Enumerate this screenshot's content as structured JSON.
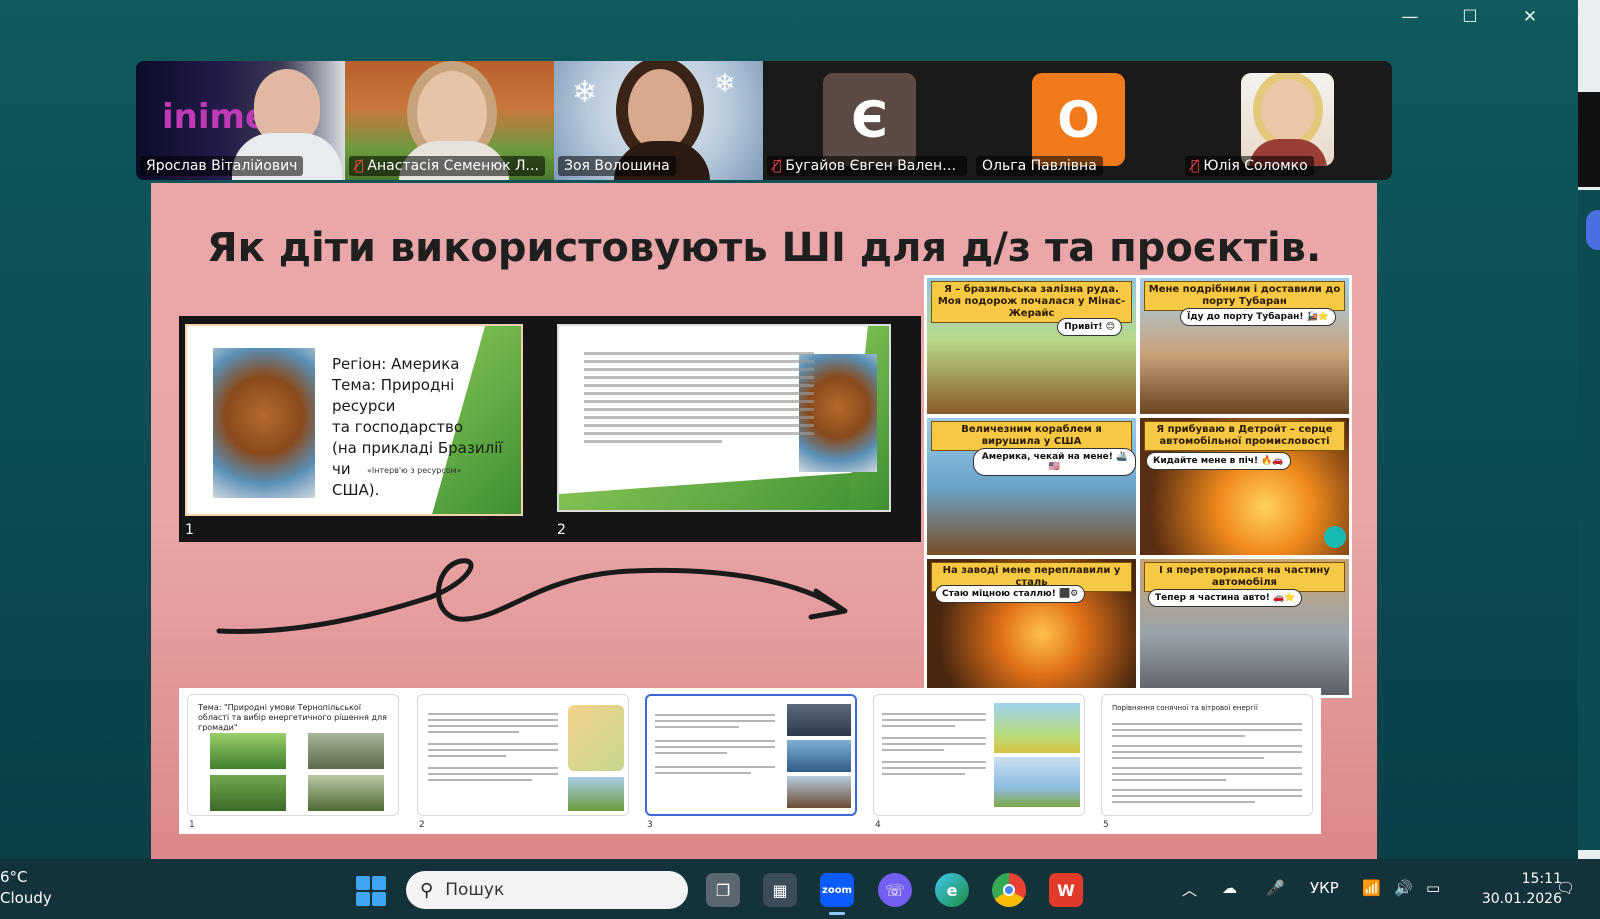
{
  "window": {
    "minimize_icon": "—",
    "maximize_icon": "☐",
    "close_icon": "✕"
  },
  "participants": [
    {
      "name": "Ярослав Віталійович",
      "muted": false,
      "type": "video"
    },
    {
      "name": "Анастасія Семенюк Л...",
      "muted": true,
      "type": "video"
    },
    {
      "name": "Зоя Волошина",
      "muted": false,
      "type": "video",
      "active": true
    },
    {
      "name": "Бугайов Євген Валент...",
      "muted": true,
      "type": "avatar",
      "letter": "Є",
      "color": "#5c4a44"
    },
    {
      "name": "Ольга Павлівна",
      "muted": false,
      "type": "avatar",
      "letter": "О",
      "color": "#f27a1a"
    },
    {
      "name": "Юлія Соломко",
      "muted": true,
      "type": "video"
    }
  ],
  "tile1_logo": "inime",
  "slide": {
    "title": "Як діти використовують ШІ для д/з та проєктів.",
    "mini1": {
      "lines": [
        "Регіон: Америка",
        "Тема: Природні ресурси",
        "та господарство",
        " (на прикладі Бразилії чи",
        "США)."
      ],
      "sub": "«Інтерв'ю з ресурсом»",
      "num": "1"
    },
    "mini2": {
      "num": "2"
    },
    "comic": [
      {
        "caption": "Я – бразильська залізна руда. Моя подорож почалася у Мінас-Жерайс",
        "bubble": "Привіт! 😊"
      },
      {
        "caption": "Мене подрібнили і доставили до порту Тубаран",
        "bubble": "Їду до порту Тубаран! 🚂⭐"
      },
      {
        "caption": "Величезним кораблем я вирушила у США",
        "bubble": "Америка, чекай на мене! 🚢🇺🇸"
      },
      {
        "caption": "Я прибуваю в Детройт – серце автомобільної промисловості",
        "bubble": "Кидайте мене в піч! 🔥🚗"
      },
      {
        "caption": "На заводі мене переплавили у сталь",
        "bubble": "Стаю міцною сталлю! ⬛⚙"
      },
      {
        "caption": "І я перетворилася на частину автомобіля",
        "bubble": "Тепер я частина авто! 🚗⭐"
      }
    ],
    "thumbs": [
      {
        "num": "1",
        "title": "Тема: \"Природні умови Тернопільської області та вибір енергетичного рішення для громади\""
      },
      {
        "num": "2",
        "title": ""
      },
      {
        "num": "3",
        "title": ""
      },
      {
        "num": "4",
        "title": ""
      },
      {
        "num": "5",
        "title": "Порівняння сонячної та вітрової енергії"
      }
    ]
  },
  "taskbar": {
    "weather_temp": "6°C",
    "weather_desc": "Cloudy",
    "search_placeholder": "Пошук",
    "zoom_label": "zoom",
    "language": "УКР",
    "time": "15:11",
    "date": "30.01.2026"
  },
  "colors": {
    "accent_active_tile": "#2ecc71",
    "slide_bg": "#eaa7a9",
    "taskbar_bg": "#13323a"
  }
}
